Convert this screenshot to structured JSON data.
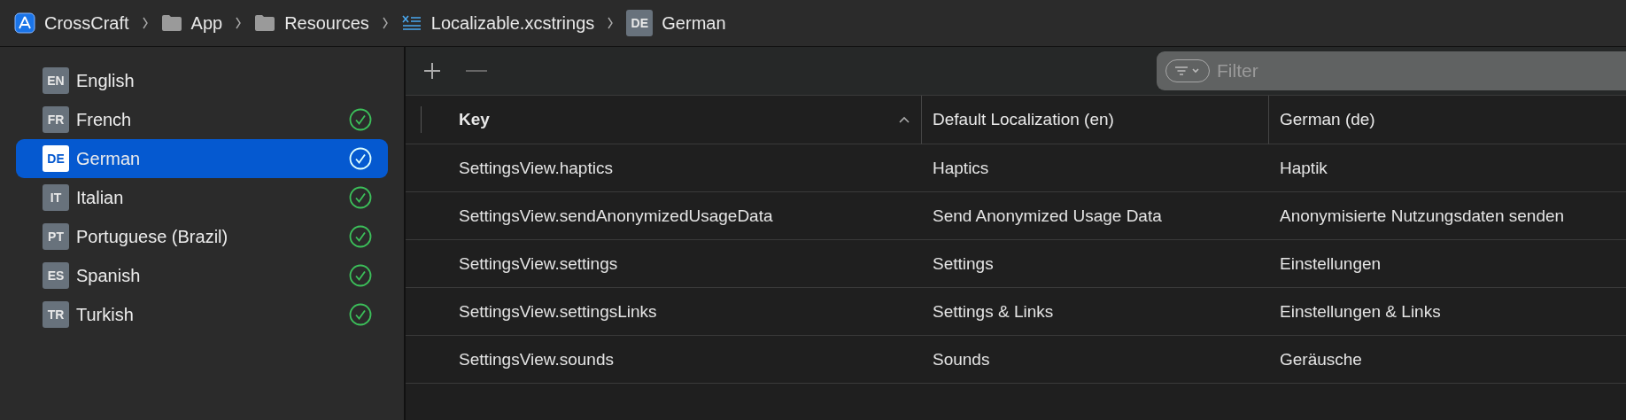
{
  "breadcrumbs": [
    {
      "kind": "app",
      "label": "CrossCraft"
    },
    {
      "kind": "folder",
      "label": "App"
    },
    {
      "kind": "folder",
      "label": "Resources"
    },
    {
      "kind": "strings",
      "label": "Localizable.xcstrings"
    },
    {
      "kind": "language",
      "code": "DE",
      "label": "German"
    }
  ],
  "languages": [
    {
      "code": "EN",
      "name": "English",
      "selected": false,
      "complete": false
    },
    {
      "code": "FR",
      "name": "French",
      "selected": false,
      "complete": true
    },
    {
      "code": "DE",
      "name": "German",
      "selected": true,
      "complete": true
    },
    {
      "code": "IT",
      "name": "Italian",
      "selected": false,
      "complete": true
    },
    {
      "code": "PT",
      "name": "Portuguese (Brazil)",
      "selected": false,
      "complete": true
    },
    {
      "code": "ES",
      "name": "Spanish",
      "selected": false,
      "complete": true
    },
    {
      "code": "TR",
      "name": "Turkish",
      "selected": false,
      "complete": true
    }
  ],
  "filter": {
    "placeholder": "Filter"
  },
  "table": {
    "columns": [
      {
        "label": "Key",
        "sorted": true
      },
      {
        "label": "Default Localization (en)",
        "sorted": false
      },
      {
        "label": "German (de)",
        "sorted": false
      }
    ],
    "rows": [
      [
        "SettingsView.haptics",
        "Haptics",
        "Haptik"
      ],
      [
        "SettingsView.sendAnonymizedUsageData",
        "Send Anonymized Usage Data",
        "Anonymisierte Nutzungsdaten senden"
      ],
      [
        "SettingsView.settings",
        "Settings",
        "Einstellungen"
      ],
      [
        "SettingsView.settingsLinks",
        "Settings & Links",
        "Einstellungen & Links"
      ],
      [
        "SettingsView.sounds",
        "Sounds",
        "Geräusche"
      ]
    ]
  }
}
